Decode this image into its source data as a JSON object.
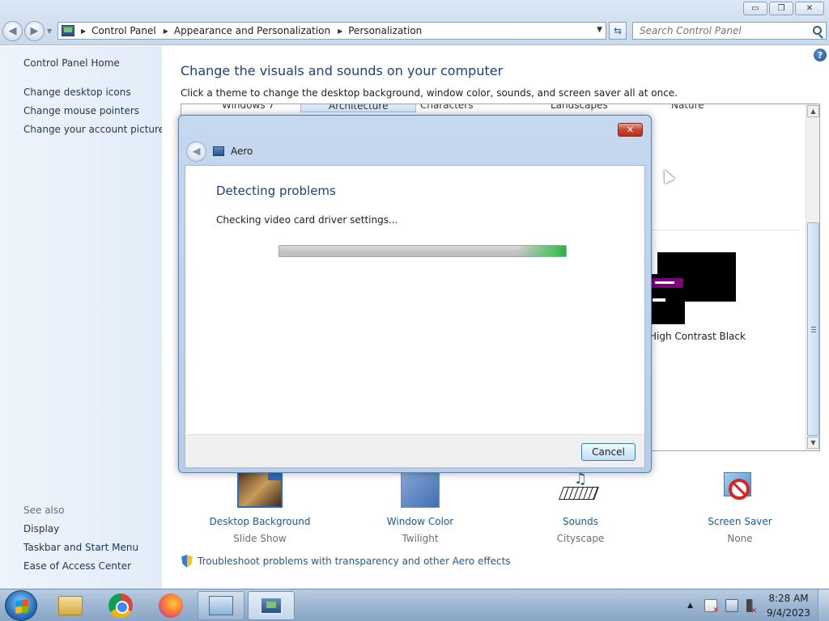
{
  "window": {
    "caption_buttons": {
      "minimize": "▭",
      "maximize": "❐",
      "close": "✕"
    }
  },
  "addressbar": {
    "icon": "control-panel-icon",
    "breadcrumbs": [
      "Control Panel",
      "Appearance and Personalization",
      "Personalization"
    ]
  },
  "search": {
    "placeholder": "Search Control Panel"
  },
  "sidebar": {
    "home": "Control Panel Home",
    "links": [
      "Change desktop icons",
      "Change mouse pointers",
      "Change your account picture"
    ],
    "see_also_title": "See also",
    "see_also": [
      "Display",
      "Taskbar and Start Menu",
      "Ease of Access Center"
    ]
  },
  "main": {
    "title": "Change the visuals and sounds on your computer",
    "subtitle": "Click a theme to change the desktop background, window color, sounds, and screen saver all at once.",
    "theme_tabs": [
      "Windows 7",
      "Architecture",
      "Characters",
      "Landscapes",
      "Nature"
    ],
    "high_contrast_label": "High Contrast Black",
    "tiles": [
      {
        "label": "Desktop Background",
        "value": "Slide Show",
        "icon": "desktop-background-icon"
      },
      {
        "label": "Window Color",
        "value": "Twilight",
        "icon": "window-color-icon"
      },
      {
        "label": "Sounds",
        "value": "Cityscape",
        "icon": "sounds-icon"
      },
      {
        "label": "Screen Saver",
        "value": "None",
        "icon": "screen-saver-icon"
      }
    ],
    "troubleshoot_link": "Troubleshoot problems with transparency and other Aero effects",
    "help": "?"
  },
  "dialog": {
    "title": "Aero",
    "heading": "Detecting problems",
    "status": "Checking video card driver settings...",
    "progress": 1.0,
    "cancel_label": "Cancel",
    "close": "✕"
  },
  "taskbar": {
    "apps": [
      "Windows Explorer",
      "Google Chrome",
      "Firefox",
      "Control Panel",
      "Personalization"
    ],
    "clock_time": "8:28 AM",
    "clock_date": "9/4/2023"
  },
  "colors": {
    "accent_title": "#1e3f86",
    "link": "#1e5aa0",
    "sidebar_bg": "#e2ecf8",
    "progress_green": "#4cc060"
  }
}
